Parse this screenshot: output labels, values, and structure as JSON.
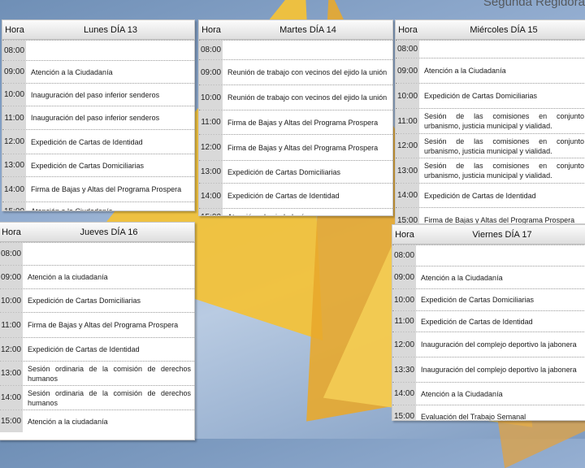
{
  "title": "Segunda Regidora",
  "hora_label": "Hora",
  "lunes": {
    "day": "Lunes DÍA 13",
    "rows": [
      {
        "time": "08:00",
        "event": ""
      },
      {
        "time": "09:00",
        "event": "Atención a la Ciudadanía"
      },
      {
        "time": "10:00",
        "event": "Inauguración del paso inferior senderos"
      },
      {
        "time": "11:00",
        "event": "Inauguración del paso inferior senderos"
      },
      {
        "time": "12:00",
        "event": "Expedición de Cartas de Identidad"
      },
      {
        "time": "13:00",
        "event": "Expedición de Cartas Domiciliarias"
      },
      {
        "time": "14:00",
        "event": "Firma de Bajas y Altas del Programa Prospera"
      },
      {
        "time": "15:00",
        "event": "Atención a la Ciudadanía"
      }
    ]
  },
  "martes": {
    "day": "Martes DÍA 14",
    "rows": [
      {
        "time": "08:00",
        "event": ""
      },
      {
        "time": "09:00",
        "event": "Reunión de trabajo con vecinos del ejido la unión"
      },
      {
        "time": "10:00",
        "event": "Reunión de trabajo con vecinos del ejido la unión"
      },
      {
        "time": "11:00",
        "event": "Firma de Bajas y Altas del Programa Prospera"
      },
      {
        "time": "12:00",
        "event": "Firma de Bajas y Altas del Programa Prospera"
      },
      {
        "time": "13:00",
        "event": "Expedición de Cartas Domiciliarias"
      },
      {
        "time": "14:00",
        "event": "Expedición de Cartas de Identidad"
      },
      {
        "time": "15:00",
        "event": "Atención a la ciudadanía"
      }
    ]
  },
  "miercoles": {
    "day": "Miércoles DÍA 15",
    "rows": [
      {
        "time": "08:00",
        "event": ""
      },
      {
        "time": "09:00",
        "event": "Atención a la Ciudadanía"
      },
      {
        "time": "10:00",
        "event": "Expedición de Cartas Domiciliarias"
      },
      {
        "time": "11:00",
        "event": "Sesión de las comisiones en conjunto urbanismo, justicia municipal y vialidad."
      },
      {
        "time": "12:00",
        "event": "Sesión de las comisiones en conjunto urbanismo, justicia municipal y vialidad."
      },
      {
        "time": "13:00",
        "event": "Sesión de las comisiones en conjunto urbanismo, justicia municipal y vialidad."
      },
      {
        "time": "14:00",
        "event": "Expedición de Cartas de Identidad"
      },
      {
        "time": "15:00",
        "event": "Firma de Bajas y Altas del Programa Prospera"
      }
    ]
  },
  "jueves": {
    "day": "Jueves DÍA 16",
    "rows": [
      {
        "time": "08:00",
        "event": ""
      },
      {
        "time": "09:00",
        "event": "Atención a la ciudadanía"
      },
      {
        "time": "10:00",
        "event": "Expedición de Cartas Domiciliarias"
      },
      {
        "time": "11:00",
        "event": "Firma de Bajas y Altas del Programa Prospera"
      },
      {
        "time": "12:00",
        "event": "Expedición de Cartas de Identidad"
      },
      {
        "time": "13:00",
        "event": "Sesión ordinaria de la comisión de derechos humanos"
      },
      {
        "time": "14:00",
        "event": "Sesión ordinaria de la comisión de derechos humanos"
      },
      {
        "time": "15:00",
        "event": "Atención a la ciudadanía"
      }
    ]
  },
  "viernes": {
    "day": "Viernes DÍA 17",
    "rows": [
      {
        "time": "08:00",
        "event": ""
      },
      {
        "time": "09:00",
        "event": "Atención a la Ciudadanía"
      },
      {
        "time": "10:00",
        "event": "Expedición de Cartas Domiciliarias"
      },
      {
        "time": "11:00",
        "event": "Expedición de Cartas de Identidad"
      },
      {
        "time": "12:00",
        "event": "Inauguración del complejo deportivo la jabonera"
      },
      {
        "time": "13:30",
        "event": "Inauguración del complejo deportivo la jabonera"
      },
      {
        "time": "14:00",
        "event": "Atención a la Ciudadanía"
      },
      {
        "time": "15:00",
        "event": "Evaluación del Trabajo Semanal"
      }
    ]
  }
}
